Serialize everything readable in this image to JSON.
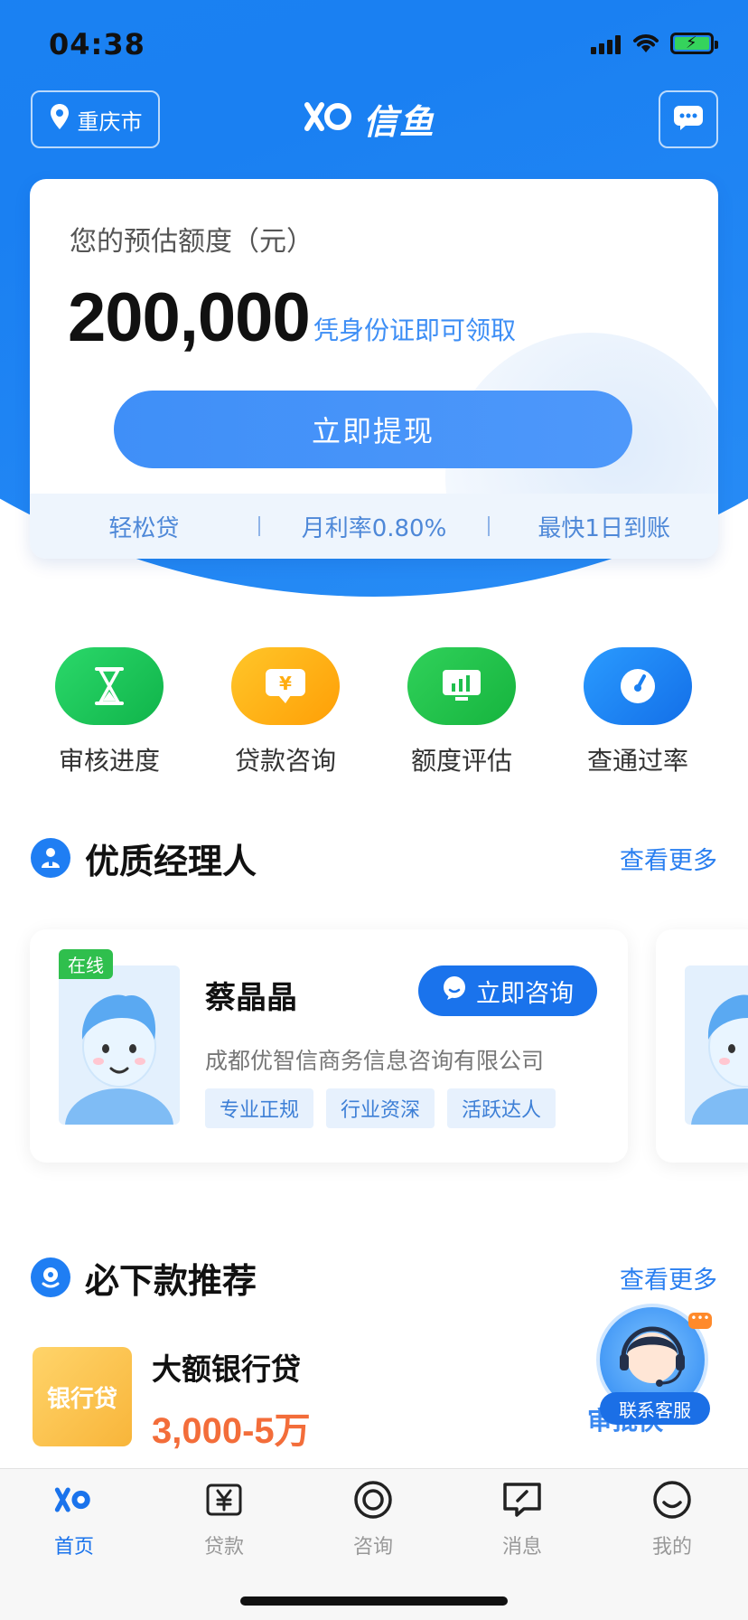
{
  "status_bar": {
    "time": "04:38"
  },
  "header": {
    "location": "重庆市",
    "logo_text": "信鱼"
  },
  "quota_card": {
    "label": "您的预估额度（元）",
    "amount": "200,000",
    "note": "凭身份证即可领取",
    "button": "立即提现",
    "features": [
      "轻松贷",
      "月利率0.80%",
      "最快1日到账"
    ]
  },
  "quick_actions": [
    {
      "label": "审核进度",
      "icon": "hourglass-icon",
      "color": "#1fc45a"
    },
    {
      "label": "贷款咨询",
      "icon": "yen-chat-icon",
      "color": "#ffb10a"
    },
    {
      "label": "额度评估",
      "icon": "chart-screen-icon",
      "color": "#22c24a"
    },
    {
      "label": "查通过率",
      "icon": "gauge-icon",
      "color": "#1a86f5"
    }
  ],
  "managers_section": {
    "title": "优质经理人",
    "more": "查看更多"
  },
  "manager": {
    "status": "在线",
    "name": "蔡晶晶",
    "consult": "立即咨询",
    "company": "成都优智信商务信息咨询有限公司",
    "tags": [
      "专业正规",
      "行业资深",
      "活跃达人"
    ]
  },
  "products_section": {
    "title": "必下款推荐",
    "more": "查看更多"
  },
  "product": {
    "image_text": "银行贷",
    "name": "大额银行贷",
    "range": "3,000-5万",
    "action": "审批快"
  },
  "customer_service": {
    "label": "联系客服"
  },
  "tabbar": [
    {
      "label": "首页",
      "icon": "home-logo-icon",
      "active": true
    },
    {
      "label": "贷款",
      "icon": "yen-icon",
      "active": false
    },
    {
      "label": "咨询",
      "icon": "target-icon",
      "active": false
    },
    {
      "label": "消息",
      "icon": "message-icon",
      "active": false
    },
    {
      "label": "我的",
      "icon": "smile-icon",
      "active": false
    }
  ],
  "colors": {
    "brand_blue": "#1a80f2",
    "accent_orange": "#f36d3a",
    "online_green": "#2fbf4d"
  }
}
